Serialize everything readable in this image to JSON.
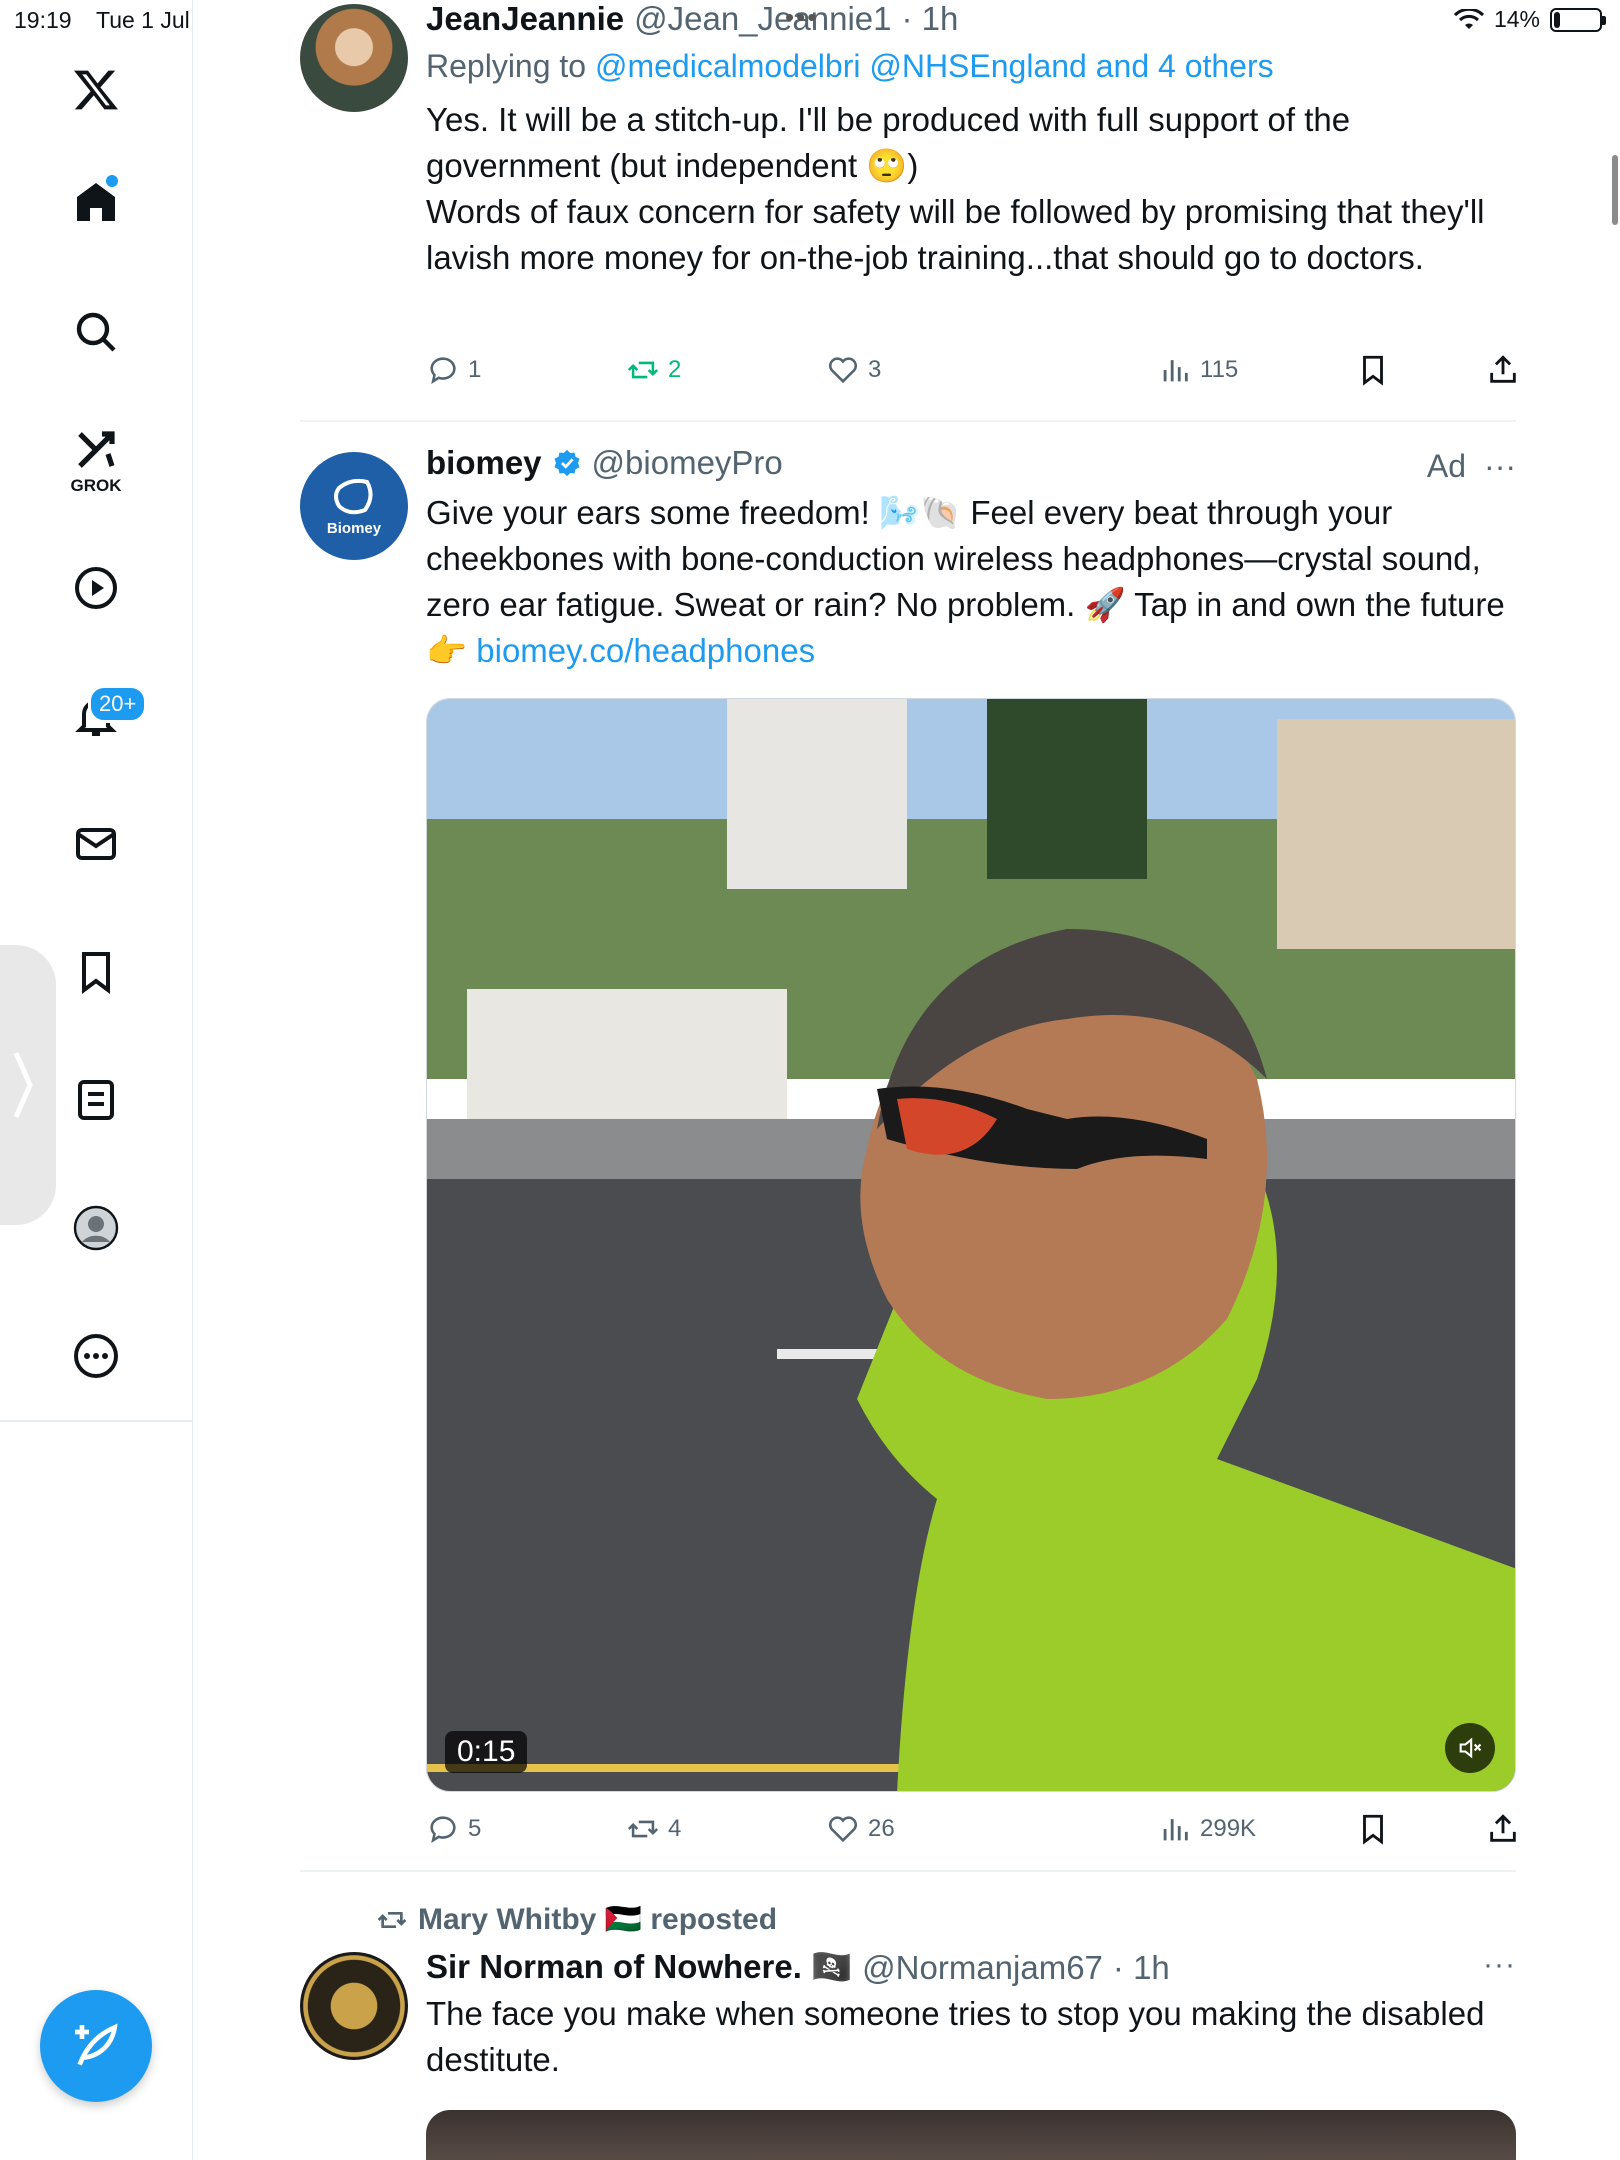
{
  "status_bar": {
    "time": "19:19",
    "date": "Tue 1 Jul",
    "battery": "14%",
    "battery_level": 0.14
  },
  "sidebar": {
    "items": [
      {
        "name": "x-logo"
      },
      {
        "name": "home"
      },
      {
        "name": "search"
      },
      {
        "name": "grok",
        "label": "GROK"
      },
      {
        "name": "videos"
      },
      {
        "name": "notifications",
        "badge": "20+"
      },
      {
        "name": "messages"
      },
      {
        "name": "bookmarks"
      },
      {
        "name": "lists"
      },
      {
        "name": "profile"
      },
      {
        "name": "more"
      }
    ]
  },
  "feed": {
    "tweets": [
      {
        "name": "JeanJeannie",
        "handle": "@Jean_Jeannie1",
        "time": "· 1h",
        "reply_prefix": "Replying to",
        "reply_to": "@medicalmodelbri @NHSEngland and 4 others",
        "text_1": "Yes. It will be a stitch-up. I'll be produced with full support of the government (but independent 🙄)",
        "text_2": "Words of faux concern for safety will be followed by promising that they'll lavish more money for on-the-job training...that should go to doctors.",
        "replies": "1",
        "reposts": "2",
        "likes": "3",
        "views": "115"
      },
      {
        "name": "biomey",
        "handle": "@biomeyPro",
        "ad_label": "Ad",
        "avatar_label": "Biomey",
        "text": "Give your ears some freedom! 🌬️🐚 Feel every beat through your cheekbones with bone-conduction wireless headphones—crystal sound, zero ear fatigue. Sweat or rain? No problem. 🚀 Tap in and own the future 👉",
        "link": "biomey.co/headphones",
        "video_duration": "0:15",
        "replies": "5",
        "reposts": "4",
        "likes": "26",
        "views": "299K"
      },
      {
        "repost_by": "Mary Whitby 🇵🇸 reposted",
        "name": "Sir Norman of Nowhere. 🏴‍☠️",
        "handle": "@Normanjam67",
        "time": "· 1h",
        "text": "The face you make when someone tries to stop you making the disabled destitute."
      }
    ]
  },
  "colors": {
    "accent": "#1d9bf0",
    "repost_green": "#00ba7c",
    "secondary_text": "#536471"
  }
}
